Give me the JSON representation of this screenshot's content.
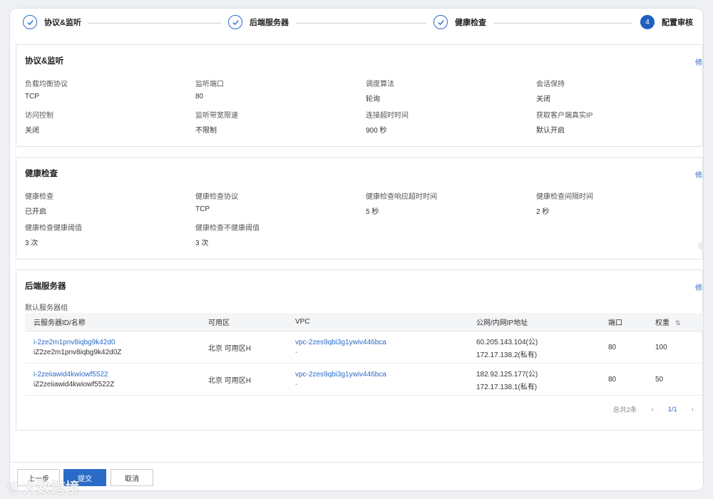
{
  "steps": [
    {
      "label": "协议&监听",
      "done": true
    },
    {
      "label": "后端服务器",
      "done": true
    },
    {
      "label": "健康检查",
      "done": true
    },
    {
      "label": "配置审核",
      "number": "4",
      "active": true
    }
  ],
  "protocol_section": {
    "title": "协议&监听",
    "edit": "修改",
    "fields": [
      {
        "label": "负载均衡协议",
        "value": "TCP"
      },
      {
        "label": "监听端口",
        "value": "80"
      },
      {
        "label": "调度算法",
        "value": "轮询"
      },
      {
        "label": "会话保持",
        "value": "关闭"
      },
      {
        "label": "访问控制",
        "value": "关闭"
      },
      {
        "label": "监听带宽限速",
        "value": "不限制"
      },
      {
        "label": "连接超时时间",
        "value": "900 秒"
      },
      {
        "label": "获取客户端真实IP",
        "value": "默认开启"
      }
    ]
  },
  "health_section": {
    "title": "健康检查",
    "edit": "修改",
    "fields": [
      {
        "label": "健康检查",
        "value": "已开启"
      },
      {
        "label": "健康检查协议",
        "value": "TCP"
      },
      {
        "label": "健康检查响应超时时间",
        "value": "5 秒"
      },
      {
        "label": "健康检查间隔时间",
        "value": "2 秒"
      },
      {
        "label": "健康检查健康阈值",
        "value": "3 次"
      },
      {
        "label": "健康检查不健康阈值",
        "value": "3 次"
      }
    ]
  },
  "backend_section": {
    "title": "后端服务器",
    "edit": "修改",
    "group_label": "默认服务器组",
    "columns": [
      "云服务器ID/名称",
      "可用区",
      "VPC",
      "公网/内网IP地址",
      "端口",
      "权重"
    ],
    "rows": [
      {
        "id": "i-2ze2m1pnv8iqbg9k42d0",
        "name": "iZ2ze2m1pnv8iqbg9k42d0Z",
        "zone": "北京 可用区H",
        "vpc": "vpc-2zes9qbi3g1ywiv446bca",
        "vpc_sub": "-",
        "public_ip": "60.205.143.104(公)",
        "private_ip": "172.17.138.2(私有)",
        "port": "80",
        "weight": "100"
      },
      {
        "id": "i-2zeiiawid4kwiowf5522",
        "name": "iZ2zeiiawid4kwiowf5522Z",
        "zone": "北京 可用区H",
        "vpc": "vpc-2zes9qbi3g1ywiv446bca",
        "vpc_sub": "-",
        "public_ip": "182.92.125.177(公)",
        "private_ip": "172.17.138.1(私有)",
        "port": "80",
        "weight": "50"
      }
    ],
    "pagination": {
      "total": "总共2条",
      "page": "1/1"
    }
  },
  "footer": {
    "prev": "上一步",
    "submit": "提交",
    "cancel": "取消"
  },
  "watermark": "大数跨境"
}
